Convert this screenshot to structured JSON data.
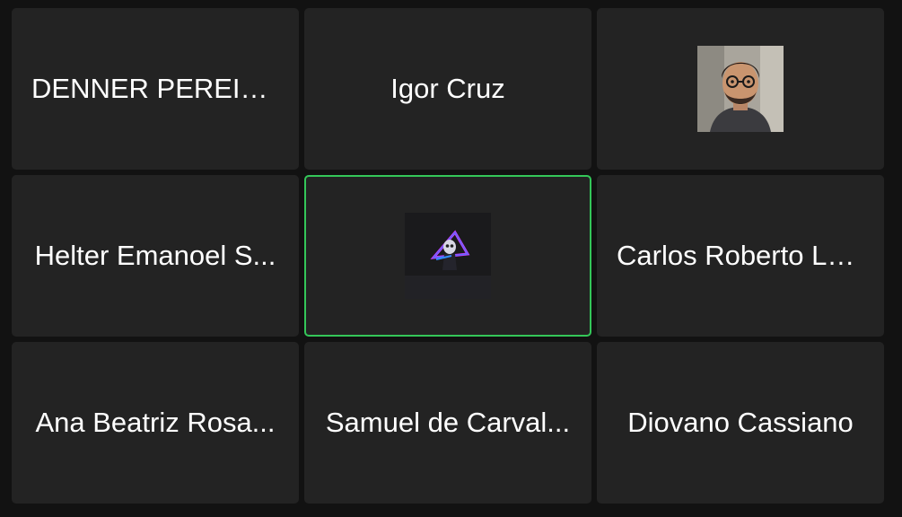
{
  "participants": [
    {
      "name": "DENNER PEREIR...",
      "has_avatar": false
    },
    {
      "name": "Igor Cruz",
      "has_avatar": false
    },
    {
      "name": "",
      "has_avatar": true,
      "avatar": "person-with-glasses-photo"
    },
    {
      "name": "Helter Emanoel S...",
      "has_avatar": false
    },
    {
      "name": "",
      "has_avatar": true,
      "avatar": "neon-triangle-skull-art",
      "active_speaker": true
    },
    {
      "name": "Carlos Roberto La...",
      "has_avatar": false
    },
    {
      "name": "Ana Beatriz Rosa...",
      "has_avatar": false
    },
    {
      "name": "Samuel de Carval...",
      "has_avatar": false
    },
    {
      "name": "Diovano Cassiano",
      "has_avatar": false
    }
  ],
  "colors": {
    "background": "#121212",
    "tile": "#232323",
    "active_border": "#34c759",
    "text": "#ffffff"
  }
}
